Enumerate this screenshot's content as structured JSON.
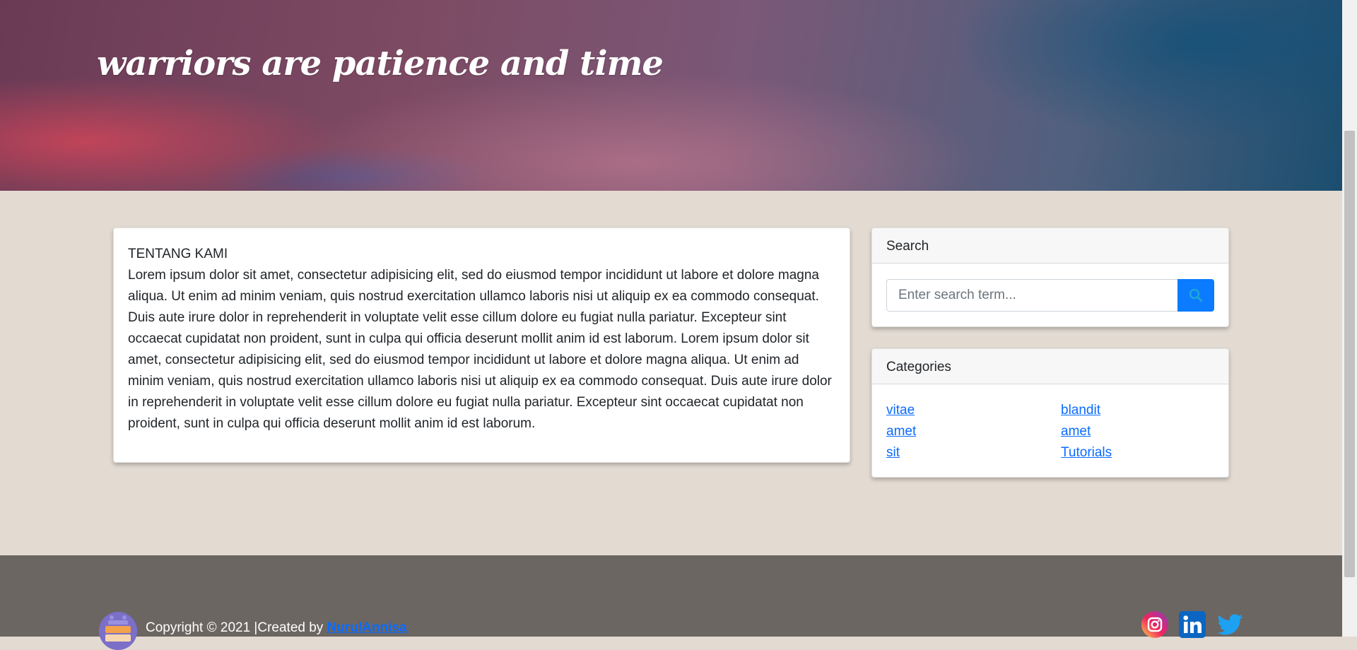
{
  "hero": {
    "title": "warriors are patience and time"
  },
  "about": {
    "heading": "TENTANG KAMI",
    "body": "Lorem ipsum dolor sit amet, consectetur adipisicing elit, sed do eiusmod tempor incididunt ut labore et dolore magna aliqua. Ut enim ad minim veniam, quis nostrud exercitation ullamco laboris nisi ut aliquip ex ea commodo consequat. Duis aute irure dolor in reprehenderit in voluptate velit esse cillum dolore eu fugiat nulla pariatur. Excepteur sint occaecat cupidatat non proident, sunt in culpa qui officia deserunt mollit anim id est laborum. Lorem ipsum dolor sit amet, consectetur adipisicing elit, sed do eiusmod tempor incididunt ut labore et dolore magna aliqua. Ut enim ad minim veniam, quis nostrud exercitation ullamco laboris nisi ut aliquip ex ea commodo consequat. Duis aute irure dolor in reprehenderit in voluptate velit esse cillum dolore eu fugiat nulla pariatur. Excepteur sint occaecat cupidatat non proident, sunt in culpa qui officia deserunt mollit anim id est laborum."
  },
  "search": {
    "header": "Search",
    "placeholder": "Enter search term...",
    "button_icon": "search-icon"
  },
  "categories": {
    "header": "Categories",
    "items": [
      "vitae",
      "blandit",
      "amet",
      "amet",
      "sit",
      "Tutorials"
    ]
  },
  "footer": {
    "copyright": "Copyright © 2021 |Created by ",
    "author": "NurulAnnisa",
    "social_icons": [
      "instagram-icon",
      "linkedin-icon",
      "twitter-icon"
    ]
  },
  "colors": {
    "accent": "#0b7bff",
    "page_background": "#e3dbd2",
    "footer_background": "#6b6662"
  }
}
